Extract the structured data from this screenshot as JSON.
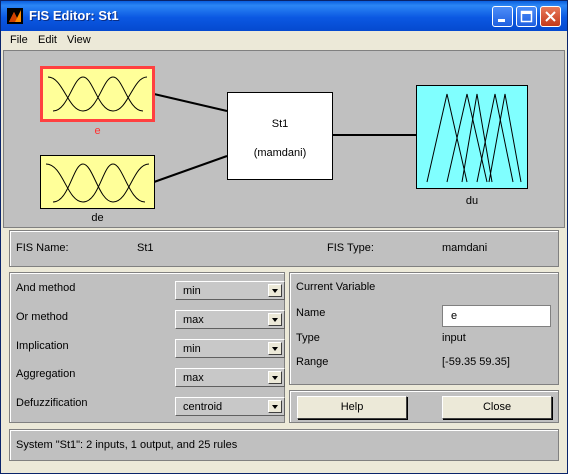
{
  "window": {
    "title": "FIS Editor: St1"
  },
  "menu": {
    "items": [
      "File",
      "Edit",
      "View"
    ]
  },
  "diagram": {
    "inputs": [
      {
        "label": "e",
        "selected": true
      },
      {
        "label": "de",
        "selected": false
      }
    ],
    "system": {
      "name": "St1",
      "type_label": "(mamdani)"
    },
    "output": {
      "label": "du"
    },
    "colors": {
      "input_fill": "#ffff99",
      "output_fill": "#80ffff",
      "selected_border": "#ff4040",
      "selected_label": "#ff3030"
    }
  },
  "info": {
    "fis_name_label": "FIS Name:",
    "fis_name": "St1",
    "fis_type_label": "FIS Type:",
    "fis_type": "mamdani"
  },
  "methods": [
    {
      "label": "And method",
      "value": "min"
    },
    {
      "label": "Or method",
      "value": "max"
    },
    {
      "label": "Implication",
      "value": "min"
    },
    {
      "label": "Aggregation",
      "value": "max"
    },
    {
      "label": "Defuzzification",
      "value": "centroid"
    }
  ],
  "current_variable": {
    "heading": "Current Variable",
    "name_label": "Name",
    "name_value": "e",
    "type_label": "Type",
    "type_value": "input",
    "range_label": "Range",
    "range_value": "[-59.35 59.35]"
  },
  "buttons": {
    "help": "Help",
    "close": "Close"
  },
  "status": {
    "text": "System \"St1\": 2 inputs, 1 output, and 25 rules"
  }
}
